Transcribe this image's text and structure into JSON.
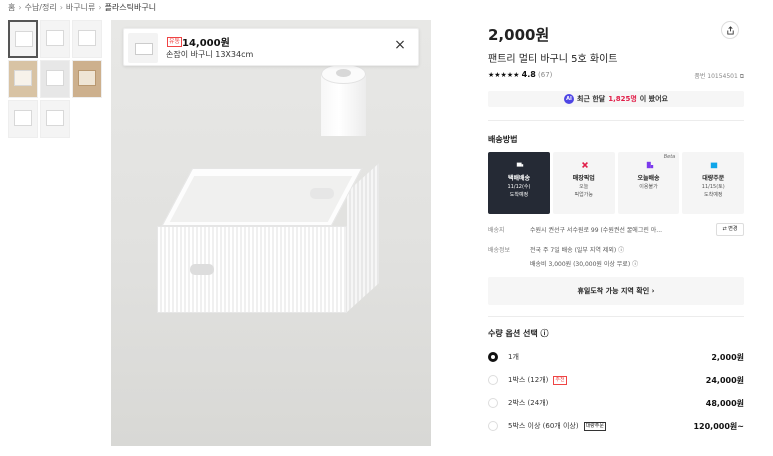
{
  "breadcrumb": [
    "홈",
    "수납/정리",
    "바구니류",
    "플라스틱바구니"
  ],
  "thumbnails": [
    {
      "kind": "main",
      "active": true
    },
    {
      "kind": "box",
      "active": false
    },
    {
      "kind": "box",
      "active": false
    },
    {
      "kind": "wood",
      "active": false
    },
    {
      "kind": "gray",
      "active": false
    },
    {
      "kind": "shelf",
      "active": false
    },
    {
      "kind": "box",
      "active": false
    },
    {
      "kind": "box",
      "active": false
    }
  ],
  "carousel": {
    "count": 8,
    "active_index": 0
  },
  "ad_card": {
    "badge": "유통",
    "price": "14,000원",
    "title": "손잡이 바구니 13X34cm"
  },
  "product": {
    "price": "2,000원",
    "name": "팬트리 멀티 바구니 5호 화이트",
    "stars": "★★★★★",
    "rating": "4.8",
    "review_count": "(67)",
    "code": "품번 10154501 ⧉"
  },
  "viewed": {
    "ai_label": "AI",
    "prefix": "최근 한달",
    "count": "1,825명",
    "suffix": "이 봤어요"
  },
  "shipping": {
    "title": "배송방법",
    "tabs": [
      {
        "label": "택배배송",
        "sub1": "11/12(수)",
        "sub2": "도착예정",
        "icon_color": "#ffffff",
        "active": true
      },
      {
        "label": "매장픽업",
        "sub1": "오늘",
        "sub2": "픽업가능",
        "icon_color": "#e11d48",
        "active": false
      },
      {
        "label": "오늘배송",
        "sub1": "이용불가",
        "sub2": "",
        "icon_color": "#7c3aed",
        "active": false,
        "beta": "Beta"
      },
      {
        "label": "대량주문",
        "sub1": "11/15(토)",
        "sub2": "도착예정",
        "icon_color": "#0ea5e9",
        "active": false
      }
    ],
    "dest_label": "배송지",
    "dest_value": "수원시 권선구 서수원로 99 (수원권선 꿀에그린 아...",
    "change_label": "⇄ 변경",
    "info_label": "배송정보",
    "info_line1": "전국 주 7일 배송 (일부 지역 제외) ⓘ",
    "info_line2": "배송비 3,000원 (30,000원 이상 무료) ⓘ",
    "holiday_label": "휴일도착 가능 지역 확인 ›"
  },
  "options": {
    "title": "수량 옵션 선택 ⓘ",
    "items": [
      {
        "label": "1개",
        "tag": "",
        "tag_type": "",
        "price": "2,000원",
        "selected": true
      },
      {
        "label": "1박스 (12개)",
        "tag": "추천",
        "tag_type": "red",
        "price": "24,000원",
        "selected": false
      },
      {
        "label": "2박스 (24개)",
        "tag": "",
        "tag_type": "",
        "price": "48,000원",
        "selected": false
      },
      {
        "label": "5박스 이상 (60개 이상)",
        "tag": "대량주문",
        "tag_type": "dark",
        "price": "120,000원~",
        "selected": false
      }
    ]
  }
}
